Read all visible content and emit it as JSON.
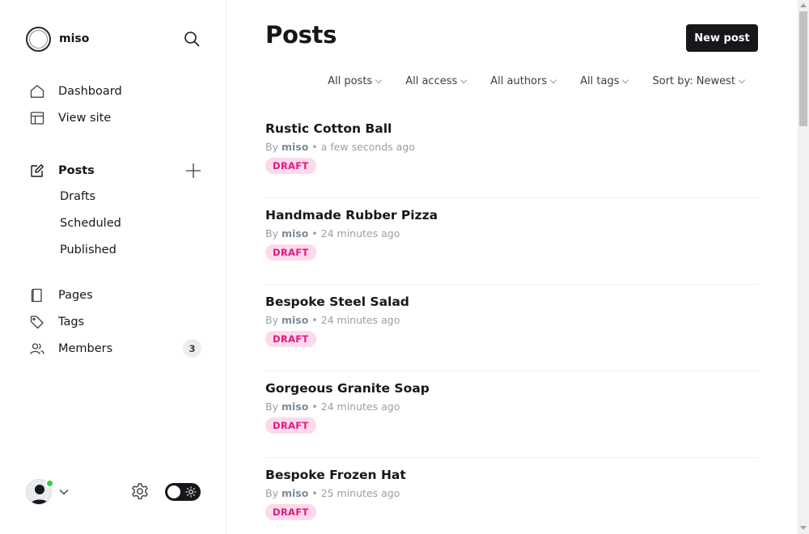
{
  "site": {
    "name": "miso"
  },
  "sidebar": {
    "primary": [
      {
        "label": "Dashboard",
        "icon": "home-icon"
      },
      {
        "label": "View site",
        "icon": "browser-layout-icon"
      }
    ],
    "posts": {
      "label": "Posts",
      "icon": "edit-icon",
      "sub": [
        "Drafts",
        "Scheduled",
        "Published"
      ]
    },
    "secondary": [
      {
        "label": "Pages",
        "icon": "page-icon"
      },
      {
        "label": "Tags",
        "icon": "tag-icon"
      },
      {
        "label": "Members",
        "icon": "members-icon",
        "count": "3"
      }
    ]
  },
  "main": {
    "title": "Posts",
    "new_post_label": "New post",
    "filters": [
      "All posts",
      "All access",
      "All authors",
      "All tags",
      "Sort by: Newest"
    ],
    "posts": [
      {
        "title": "Rustic Cotton Ball",
        "by": "By",
        "author": "miso",
        "time": "• a few seconds ago",
        "status": "DRAFT"
      },
      {
        "title": "Handmade Rubber Pizza",
        "by": "By",
        "author": "miso",
        "time": "• 24 minutes ago",
        "status": "DRAFT"
      },
      {
        "title": "Bespoke Steel Salad",
        "by": "By",
        "author": "miso",
        "time": "• 24 minutes ago",
        "status": "DRAFT"
      },
      {
        "title": "Gorgeous Granite Soap",
        "by": "By",
        "author": "miso",
        "time": "• 24 minutes ago",
        "status": "DRAFT"
      },
      {
        "title": "Bespoke Frozen Hat",
        "by": "By",
        "author": "miso",
        "time": "• 25 minutes ago",
        "status": "DRAFT"
      }
    ]
  },
  "colors": {
    "accent_dark": "#15171a",
    "draft_text": "#e01a7d",
    "draft_bg": "#fdd9ec",
    "online": "#30cf43"
  }
}
